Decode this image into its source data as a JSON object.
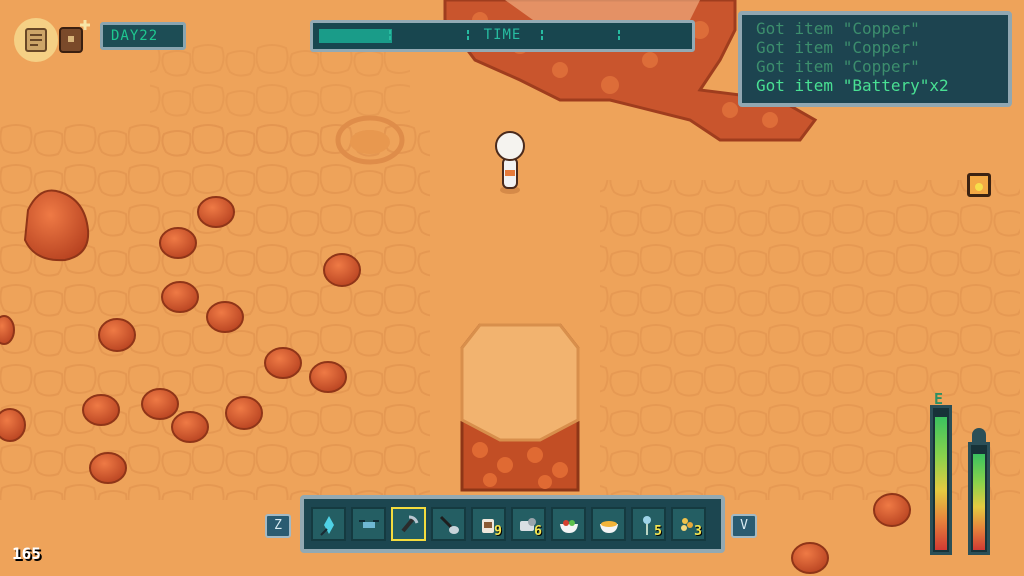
{
  "hud": {
    "day": "DAY22",
    "time_label": "TIME",
    "time_progress": 0.2,
    "messages": [
      "Got item \"Copper\"",
      "Got item \"Copper\"",
      "Got item \"Copper\"",
      "Got item \"Battery\"x2"
    ],
    "hotbar": {
      "prev_key": "Z",
      "next_key": "V",
      "selected_index": 2,
      "slots": [
        {
          "icon": "crystal-icon",
          "count": ""
        },
        {
          "icon": "drone-icon",
          "count": ""
        },
        {
          "icon": "pickaxe-icon",
          "count": ""
        },
        {
          "icon": "shovel-icon",
          "count": ""
        },
        {
          "icon": "coffee-mug-icon",
          "count": "9"
        },
        {
          "icon": "supplies-icon",
          "count": "6"
        },
        {
          "icon": "salad-bowl-icon",
          "count": ""
        },
        {
          "icon": "soup-bowl-icon",
          "count": ""
        },
        {
          "icon": "sapling-icon",
          "count": "5"
        },
        {
          "icon": "seeds-icon",
          "count": "3"
        }
      ]
    },
    "energy_label": "E",
    "energy_level": 0.95,
    "oxygen_level": 0.93,
    "coordinate": "165"
  },
  "colors": {
    "sand": "#eea35a",
    "rock": "#d55e2f",
    "panel": "#1d4450",
    "log_text": "#49e093"
  }
}
